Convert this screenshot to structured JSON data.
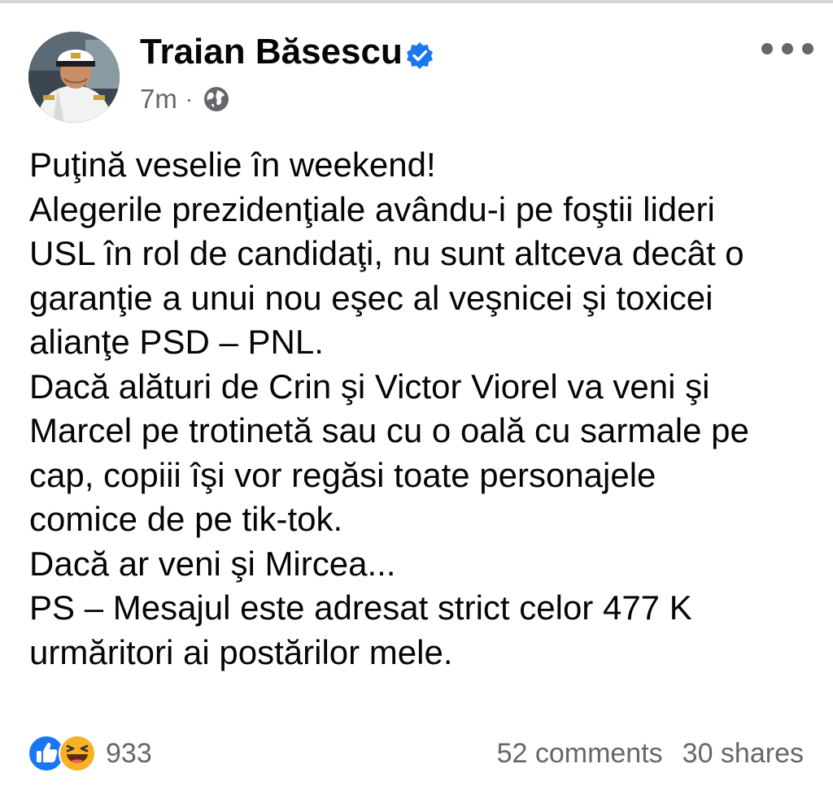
{
  "post": {
    "author": {
      "name": "Traian Băsescu",
      "verified": true,
      "avatar_icon": "profile-photo-captain"
    },
    "timestamp": "7m",
    "separator": "·",
    "audience_icon": "globe-icon",
    "text_lines": [
      "Puţină veselie în weekend!",
      "Alegerile prezidenţiale avându-i pe foştii lideri",
      "USL în rol de candidaţi,  nu sunt altceva decât o",
      "garanţie a unui nou eşec al veşnicei şi toxicei",
      "alianţe PSD – PNL.",
      "Dacă alături de Crin şi Victor Viorel va veni şi",
      "Marcel pe trotinetă sau cu o oală cu sarmale pe",
      "cap, copiii îşi vor regăsi toate personajele",
      "comice de pe tik-tok.",
      "Dacă ar veni şi Mircea...",
      "PS – Mesajul este adresat strict celor 477 K",
      "urmăritori ai postărilor mele."
    ],
    "reactions": {
      "icons": [
        "like-icon",
        "haha-icon"
      ],
      "count": "933"
    },
    "comments": "52 comments",
    "shares": "30 shares"
  },
  "colors": {
    "text": "#050505",
    "secondary_text": "#65676b",
    "facebook_blue": "#1877f2",
    "haha_yellow": "#f7b125"
  }
}
